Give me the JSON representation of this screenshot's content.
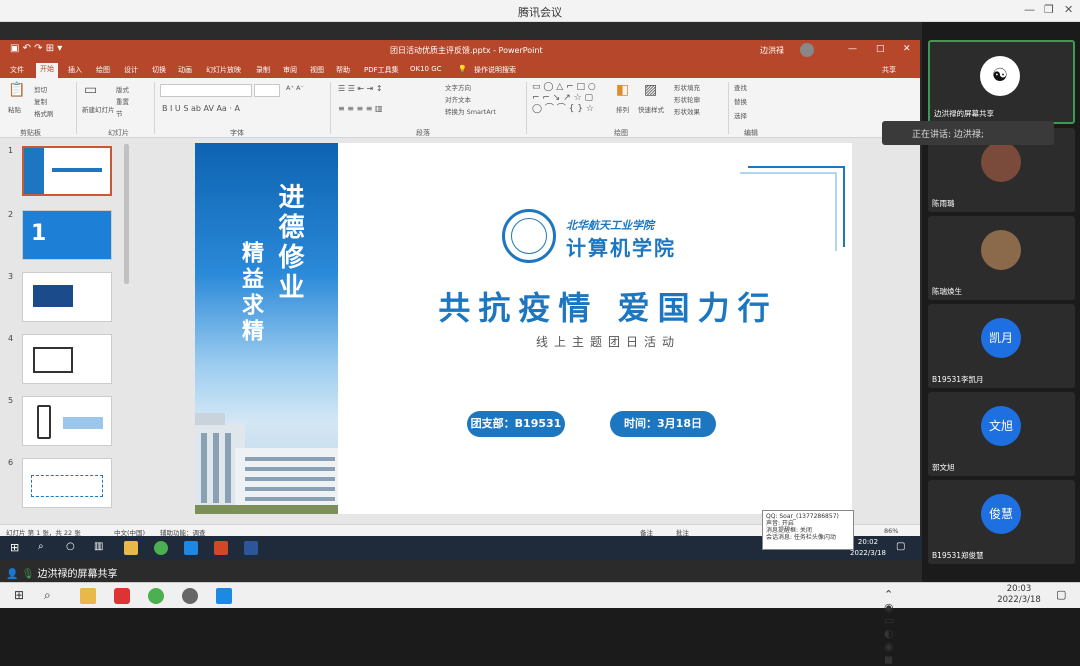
{
  "meeting": {
    "title": "腾讯会议"
  },
  "ppt": {
    "file_title": "团日活动优质主评反馈.pptx - PowerPoint",
    "user": "边洪禄",
    "share_btn": "共享",
    "tabs": [
      "文件",
      "开始",
      "插入",
      "绘图",
      "设计",
      "切换",
      "动画",
      "幻灯片放映",
      "录制",
      "审阅",
      "视图",
      "帮助",
      "PDF工具集",
      "OK10 GC",
      "操作说明搜索"
    ],
    "active_tab": "开始",
    "groups": {
      "clipboard": "剪贴板",
      "slides": "幻灯片",
      "font": "字体",
      "paragraph": "段落",
      "drawing": "绘图",
      "editing": "编辑"
    },
    "ribbon": {
      "paste": "粘贴",
      "cut": "剪切",
      "copy": "复制",
      "format_painter": "格式刷",
      "new_slide": "新建幻灯片",
      "layout": "版式",
      "reset": "重置",
      "section": "节",
      "text_direction": "文字方向",
      "align_text": "对齐文本",
      "smartart": "转换为 SmartArt",
      "arrange": "排列",
      "quick_styles": "快速样式",
      "shape_fill": "形状填充",
      "shape_outline": "形状轮廓",
      "shape_effects": "形状效果",
      "find": "查找",
      "replace": "替换",
      "select": "选择"
    },
    "thumbs": [
      "1",
      "2",
      "3",
      "4",
      "5",
      "6"
    ],
    "slide": {
      "calli_right": "进德修业",
      "calli_left": "精益求精",
      "school_small": "北华航天工业学院",
      "school_big": "计算机学院",
      "main_title": "共抗疫情  爱国力行",
      "subtitle": "线上主题团日活动",
      "pill_branch": "团支部：B19531",
      "pill_time": "时间：3月18日"
    },
    "status": {
      "slide_of": "幻灯片 第 1 张，共 22 张",
      "lang": "中文(中国)",
      "accessibility": "辅助功能：调查",
      "notes": "备注",
      "comments": "批注",
      "zoom": "86%"
    }
  },
  "inner_taskbar": {
    "time": "20:02",
    "date": "2022/3/18"
  },
  "qq_tip": {
    "line1": "QQ: Soar_(1377286857)",
    "line2": "声音: 开启",
    "line3": "消息提醒框: 关闭",
    "line4": "会话消息: 任务栏头像闪动"
  },
  "banner": {
    "text": "边洪禄的屏幕共享"
  },
  "speaking": {
    "text": "正在讲话: 边洪禄;"
  },
  "participants": [
    {
      "name": "边洪禄的屏幕共享",
      "avatar": ""
    },
    {
      "name": "陈雨璐",
      "avatar": ""
    },
    {
      "name": "陈瑞焕生",
      "avatar": ""
    },
    {
      "name": "B19531李凯月",
      "avatar": "凯月"
    },
    {
      "name": "郭文旭",
      "avatar": "文旭"
    },
    {
      "name": "B19531郑俊慧",
      "avatar": "俊慧"
    }
  ],
  "system_clock": {
    "time": "20:03",
    "date": "2022/3/18"
  },
  "colors": {
    "ppt_red": "#b7472a",
    "accent_blue": "#1d76c0",
    "avatar_blue": "#1e6fe0",
    "active_green": "#3d9a52"
  }
}
